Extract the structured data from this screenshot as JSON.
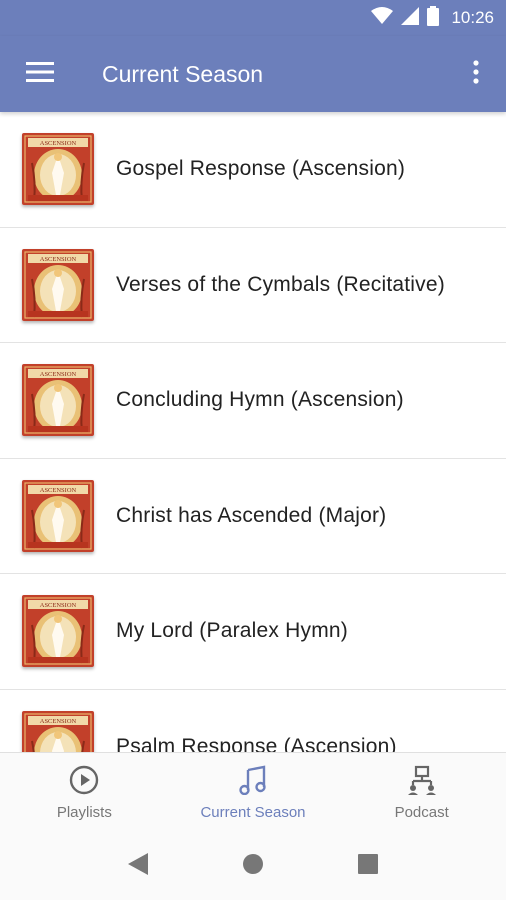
{
  "status_bar": {
    "time": "10:26"
  },
  "app_bar": {
    "title": "Current Season",
    "menu_icon": "hamburger-menu-icon",
    "more_icon": "more-vert-icon"
  },
  "album_art": {
    "caption": "Ascension"
  },
  "tracks": [
    {
      "title": "Gospel Response (Ascension)"
    },
    {
      "title": "Verses of the Cymbals (Recitative)"
    },
    {
      "title": "Concluding Hymn (Ascension)"
    },
    {
      "title": "Christ has Ascended (Major)"
    },
    {
      "title": "My Lord (Paralex Hymn)"
    },
    {
      "title": "Psalm Response (Ascension)"
    }
  ],
  "bottom_nav": {
    "items": [
      {
        "label": "Playlists",
        "icon": "play-circle-icon",
        "active": false
      },
      {
        "label": "Current Season",
        "icon": "music-note-icon",
        "active": true
      },
      {
        "label": "Podcast",
        "icon": "podcast-network-icon",
        "active": false
      }
    ]
  },
  "colors": {
    "primary": "#6c7fbb",
    "active": "#6c7fbb",
    "text": "#222222",
    "inactive": "#777777"
  }
}
